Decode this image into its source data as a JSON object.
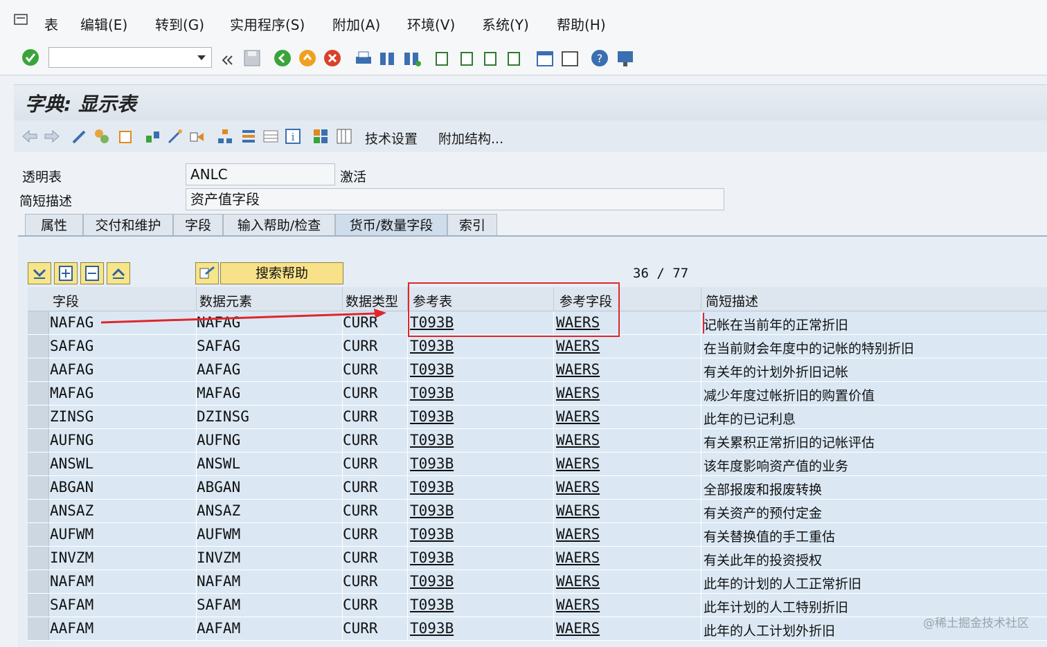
{
  "menubar": {
    "items": [
      "表",
      "编辑(E)",
      "转到(G)",
      "实用程序(S)",
      "附加(A)",
      "环境(V)",
      "系统(Y)",
      "帮助(H)"
    ]
  },
  "toolbar": {
    "command_value": "",
    "icons": [
      "enter-icon",
      "back-icon",
      "save-icon",
      "back-green-icon",
      "exit-icon",
      "cancel-icon",
      "print-icon",
      "find-icon",
      "find-next-icon",
      "first-page-icon",
      "prev-page-icon",
      "next-page-icon",
      "last-page-icon",
      "new-session-icon",
      "shortcut-icon",
      "help-icon",
      "layout-icon"
    ]
  },
  "title": "字典: 显示表",
  "app_toolbar": {
    "tech_settings": "技术设置",
    "append_struct": "附加结构..."
  },
  "header": {
    "transparent_table_label": "透明表",
    "table_name": "ANLC",
    "status": "激活",
    "short_desc_label": "简短描述",
    "short_desc_value": "资产值字段"
  },
  "tabs": [
    "属性",
    "交付和维护",
    "字段",
    "输入帮助/检查",
    "货币/数量字段",
    "索引"
  ],
  "active_tab": "货币/数量字段",
  "grid": {
    "search_help_label": "搜索帮助",
    "position": "36",
    "separator": "/",
    "total": "77",
    "columns": [
      "字段",
      "数据元素",
      "数据类型",
      "参考表",
      "参考字段",
      "简短描述"
    ],
    "rows": [
      {
        "field": "NAFAG",
        "element": "NAFAG",
        "type": "CURR",
        "ref_table": "T093B",
        "ref_field": "WAERS",
        "desc": "记帐在当前年的正常折旧"
      },
      {
        "field": "SAFAG",
        "element": "SAFAG",
        "type": "CURR",
        "ref_table": "T093B",
        "ref_field": "WAERS",
        "desc": "在当前财会年度中的记帐的特别折旧"
      },
      {
        "field": "AAFAG",
        "element": "AAFAG",
        "type": "CURR",
        "ref_table": "T093B",
        "ref_field": "WAERS",
        "desc": "有关年的计划外折旧记帐"
      },
      {
        "field": "MAFAG",
        "element": "MAFAG",
        "type": "CURR",
        "ref_table": "T093B",
        "ref_field": "WAERS",
        "desc": "减少年度过帐折旧的购置价值"
      },
      {
        "field": "ZINSG",
        "element": "DZINSG",
        "type": "CURR",
        "ref_table": "T093B",
        "ref_field": "WAERS",
        "desc": "此年的已记利息"
      },
      {
        "field": "AUFNG",
        "element": "AUFNG",
        "type": "CURR",
        "ref_table": "T093B",
        "ref_field": "WAERS",
        "desc": "有关累积正常折旧的记帐评估"
      },
      {
        "field": "ANSWL",
        "element": "ANSWL",
        "type": "CURR",
        "ref_table": "T093B",
        "ref_field": "WAERS",
        "desc": "该年度影响资产值的业务"
      },
      {
        "field": "ABGAN",
        "element": "ABGAN",
        "type": "CURR",
        "ref_table": "T093B",
        "ref_field": "WAERS",
        "desc": "全部报废和报废转换"
      },
      {
        "field": "ANSAZ",
        "element": "ANSAZ",
        "type": "CURR",
        "ref_table": "T093B",
        "ref_field": "WAERS",
        "desc": "有关资产的预付定金"
      },
      {
        "field": "AUFWM",
        "element": "AUFWM",
        "type": "CURR",
        "ref_table": "T093B",
        "ref_field": "WAERS",
        "desc": "有关替换值的手工重估"
      },
      {
        "field": "INVZM",
        "element": "INVZM",
        "type": "CURR",
        "ref_table": "T093B",
        "ref_field": "WAERS",
        "desc": "有关此年的投资授权"
      },
      {
        "field": "NAFAM",
        "element": "NAFAM",
        "type": "CURR",
        "ref_table": "T093B",
        "ref_field": "WAERS",
        "desc": "此年的计划的人工正常折旧"
      },
      {
        "field": "SAFAM",
        "element": "SAFAM",
        "type": "CURR",
        "ref_table": "T093B",
        "ref_field": "WAERS",
        "desc": "此年计划的人工特别折旧"
      },
      {
        "field": "AAFAM",
        "element": "AAFAM",
        "type": "CURR",
        "ref_table": "T093B",
        "ref_field": "WAERS",
        "desc": "此年的人工计划外折旧"
      }
    ]
  },
  "watermark": "@稀土掘金技术社区",
  "colors": {
    "annotation_red": "#e0262b",
    "row_bg": "#dbe8f4",
    "button_yellow": "#f7e28a"
  }
}
